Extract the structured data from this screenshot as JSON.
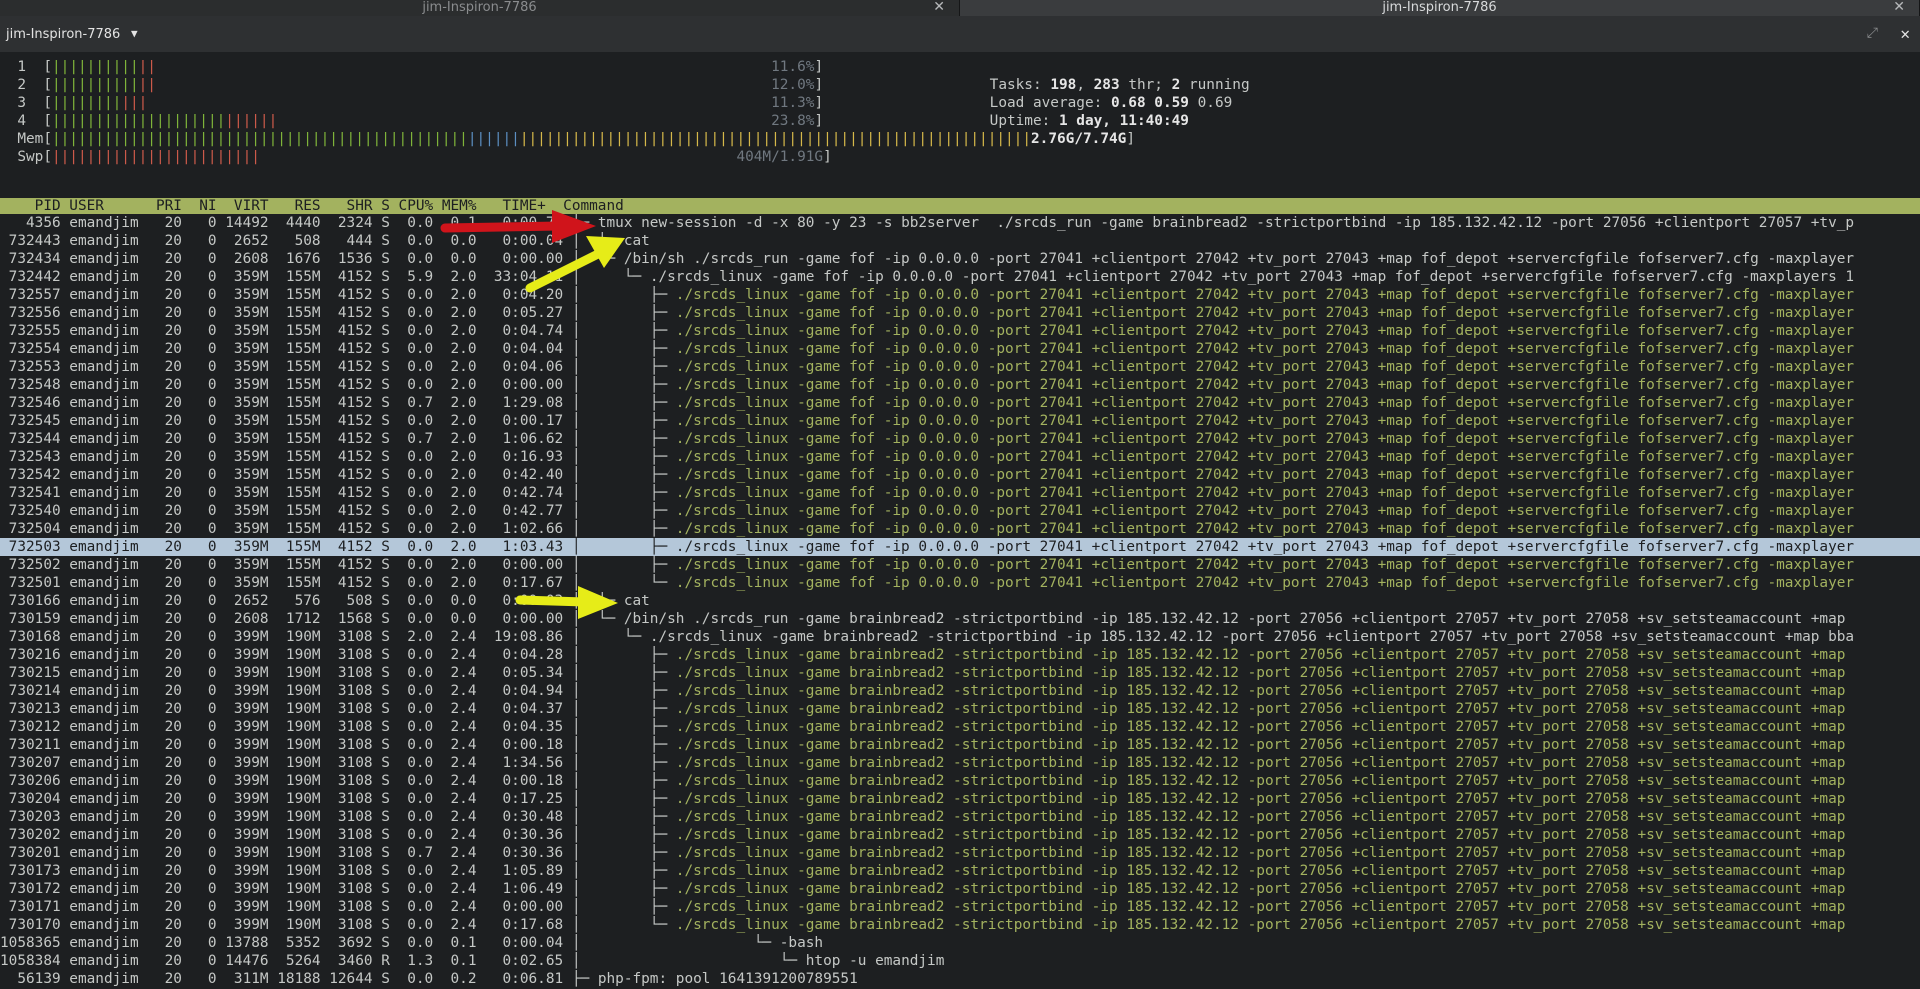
{
  "tabs": [
    {
      "label": "jim-Inspiron-7786",
      "active": false
    },
    {
      "label": "jim-Inspiron-7786",
      "active": true
    }
  ],
  "window": {
    "title": "jim-Inspiron-7786"
  },
  "meters": {
    "cpus": [
      {
        "id": "1",
        "g": "||||||||||",
        "r": "||",
        "value": "11.6%"
      },
      {
        "id": "2",
        "g": "||||||||||",
        "r": "||",
        "value": "12.0%"
      },
      {
        "id": "3",
        "g": "||||||||",
        "r": "|||",
        "value": "11.3%"
      },
      {
        "id": "4",
        "g": "||||||||||||||||||||",
        "r": "||||||",
        "value": "23.8%"
      }
    ],
    "mem": {
      "label": "Mem",
      "g": "||||||||||||||||||||||||||||||||||||||||||||||||",
      "b": "||||||",
      "y": "|||||||||||||||||||||||||||||||||||||||||||||||||||||||||||",
      "value": "2.76G/7.74G"
    },
    "swp": {
      "label": "Swp",
      "r": "||||||||||||||||||||||||",
      "value": "404M/1.91G"
    }
  },
  "summary": {
    "tasks_label": "Tasks:",
    "tasks": "198",
    "thr": "283",
    "thr_label": "thr;",
    "running": "2",
    "running_label": "running",
    "load_label": "Load average:",
    "load1": "0.68",
    "load5": "0.59",
    "load15": "0.69",
    "uptime_label": "Uptime:",
    "uptime": "1 day, 11:40:49"
  },
  "header": "    PID USER      PRI  NI  VIRT   RES   SHR S CPU% MEM%   TIME+  Command",
  "processes": [
    {
      "pid": "4356",
      "user": "emandjim",
      "pri": "20",
      "ni": "0",
      "virt": "14492",
      "res": "4440",
      "shr": "2324",
      "s": "S",
      "cpu": "0.0",
      "mem": "0.1",
      "time": "0:00.72",
      "tree": "├─ ",
      "cmd": "tmux new-session -d -x 80 -y 23 -s bb2server  ./srcds_run -game brainbread2 -strictportbind -ip 185.132.42.12 -port 27056 +clientport 27057 +tv_p",
      "g": false
    },
    {
      "pid": "732443",
      "user": "emandjim",
      "pri": "20",
      "ni": "0",
      "virt": "2652",
      "res": "508",
      "shr": "444",
      "s": "S",
      "cpu": "0.0",
      "mem": "0.0",
      "time": "0:00.04",
      "tree": "│  ├─ ",
      "cmd": "cat",
      "g": false
    },
    {
      "pid": "732434",
      "user": "emandjim",
      "pri": "20",
      "ni": "0",
      "virt": "2608",
      "res": "1676",
      "shr": "1536",
      "s": "S",
      "cpu": "0.0",
      "mem": "0.0",
      "time": "0:00.00",
      "tree": "│  └─ ",
      "cmd": "/bin/sh ./srcds_run -game fof -ip 0.0.0.0 -port 27041 +clientport 27042 +tv_port 27043 +map fof_depot +servercfgfile fofserver7.cfg -maxplayer",
      "g": false
    },
    {
      "pid": "732442",
      "user": "emandjim",
      "pri": "20",
      "ni": "0",
      "virt": "359M",
      "res": "155M",
      "shr": "4152",
      "s": "S",
      "cpu": "5.9",
      "mem": "2.0",
      "time": "33:04.11",
      "tree": "│     └─ ",
      "cmd": "./srcds_linux -game fof -ip 0.0.0.0 -port 27041 +clientport 27042 +tv_port 27043 +map fof_depot +servercfgfile fofserver7.cfg -maxplayers 1",
      "g": false
    },
    {
      "pid": "732557",
      "user": "emandjim",
      "pri": "20",
      "ni": "0",
      "virt": "359M",
      "res": "155M",
      "shr": "4152",
      "s": "S",
      "cpu": "0.0",
      "mem": "2.0",
      "time": "0:04.20",
      "tree": "│        ├─ ",
      "cmd": "./srcds_linux -game fof -ip 0.0.0.0 -port 27041 +clientport 27042 +tv_port 27043 +map fof_depot +servercfgfile fofserver7.cfg -maxplayer",
      "g": true
    },
    {
      "pid": "732556",
      "user": "emandjim",
      "pri": "20",
      "ni": "0",
      "virt": "359M",
      "res": "155M",
      "shr": "4152",
      "s": "S",
      "cpu": "0.0",
      "mem": "2.0",
      "time": "0:05.27",
      "tree": "│        ├─ ",
      "cmd": "./srcds_linux -game fof -ip 0.0.0.0 -port 27041 +clientport 27042 +tv_port 27043 +map fof_depot +servercfgfile fofserver7.cfg -maxplayer",
      "g": true
    },
    {
      "pid": "732555",
      "user": "emandjim",
      "pri": "20",
      "ni": "0",
      "virt": "359M",
      "res": "155M",
      "shr": "4152",
      "s": "S",
      "cpu": "0.0",
      "mem": "2.0",
      "time": "0:04.74",
      "tree": "│        ├─ ",
      "cmd": "./srcds_linux -game fof -ip 0.0.0.0 -port 27041 +clientport 27042 +tv_port 27043 +map fof_depot +servercfgfile fofserver7.cfg -maxplayer",
      "g": true
    },
    {
      "pid": "732554",
      "user": "emandjim",
      "pri": "20",
      "ni": "0",
      "virt": "359M",
      "res": "155M",
      "shr": "4152",
      "s": "S",
      "cpu": "0.0",
      "mem": "2.0",
      "time": "0:04.04",
      "tree": "│        ├─ ",
      "cmd": "./srcds_linux -game fof -ip 0.0.0.0 -port 27041 +clientport 27042 +tv_port 27043 +map fof_depot +servercfgfile fofserver7.cfg -maxplayer",
      "g": true
    },
    {
      "pid": "732553",
      "user": "emandjim",
      "pri": "20",
      "ni": "0",
      "virt": "359M",
      "res": "155M",
      "shr": "4152",
      "s": "S",
      "cpu": "0.0",
      "mem": "2.0",
      "time": "0:04.06",
      "tree": "│        ├─ ",
      "cmd": "./srcds_linux -game fof -ip 0.0.0.0 -port 27041 +clientport 27042 +tv_port 27043 +map fof_depot +servercfgfile fofserver7.cfg -maxplayer",
      "g": true
    },
    {
      "pid": "732548",
      "user": "emandjim",
      "pri": "20",
      "ni": "0",
      "virt": "359M",
      "res": "155M",
      "shr": "4152",
      "s": "S",
      "cpu": "0.0",
      "mem": "2.0",
      "time": "0:00.00",
      "tree": "│        ├─ ",
      "cmd": "./srcds_linux -game fof -ip 0.0.0.0 -port 27041 +clientport 27042 +tv_port 27043 +map fof_depot +servercfgfile fofserver7.cfg -maxplayer",
      "g": true
    },
    {
      "pid": "732546",
      "user": "emandjim",
      "pri": "20",
      "ni": "0",
      "virt": "359M",
      "res": "155M",
      "shr": "4152",
      "s": "S",
      "cpu": "0.7",
      "mem": "2.0",
      "time": "1:29.08",
      "tree": "│        ├─ ",
      "cmd": "./srcds_linux -game fof -ip 0.0.0.0 -port 27041 +clientport 27042 +tv_port 27043 +map fof_depot +servercfgfile fofserver7.cfg -maxplayer",
      "g": true
    },
    {
      "pid": "732545",
      "user": "emandjim",
      "pri": "20",
      "ni": "0",
      "virt": "359M",
      "res": "155M",
      "shr": "4152",
      "s": "S",
      "cpu": "0.0",
      "mem": "2.0",
      "time": "0:00.17",
      "tree": "│        ├─ ",
      "cmd": "./srcds_linux -game fof -ip 0.0.0.0 -port 27041 +clientport 27042 +tv_port 27043 +map fof_depot +servercfgfile fofserver7.cfg -maxplayer",
      "g": true
    },
    {
      "pid": "732544",
      "user": "emandjim",
      "pri": "20",
      "ni": "0",
      "virt": "359M",
      "res": "155M",
      "shr": "4152",
      "s": "S",
      "cpu": "0.7",
      "mem": "2.0",
      "time": "1:06.62",
      "tree": "│        ├─ ",
      "cmd": "./srcds_linux -game fof -ip 0.0.0.0 -port 27041 +clientport 27042 +tv_port 27043 +map fof_depot +servercfgfile fofserver7.cfg -maxplayer",
      "g": true
    },
    {
      "pid": "732543",
      "user": "emandjim",
      "pri": "20",
      "ni": "0",
      "virt": "359M",
      "res": "155M",
      "shr": "4152",
      "s": "S",
      "cpu": "0.0",
      "mem": "2.0",
      "time": "0:16.93",
      "tree": "│        ├─ ",
      "cmd": "./srcds_linux -game fof -ip 0.0.0.0 -port 27041 +clientport 27042 +tv_port 27043 +map fof_depot +servercfgfile fofserver7.cfg -maxplayer",
      "g": true
    },
    {
      "pid": "732542",
      "user": "emandjim",
      "pri": "20",
      "ni": "0",
      "virt": "359M",
      "res": "155M",
      "shr": "4152",
      "s": "S",
      "cpu": "0.0",
      "mem": "2.0",
      "time": "0:42.40",
      "tree": "│        ├─ ",
      "cmd": "./srcds_linux -game fof -ip 0.0.0.0 -port 27041 +clientport 27042 +tv_port 27043 +map fof_depot +servercfgfile fofserver7.cfg -maxplayer",
      "g": true
    },
    {
      "pid": "732541",
      "user": "emandjim",
      "pri": "20",
      "ni": "0",
      "virt": "359M",
      "res": "155M",
      "shr": "4152",
      "s": "S",
      "cpu": "0.0",
      "mem": "2.0",
      "time": "0:42.74",
      "tree": "│        ├─ ",
      "cmd": "./srcds_linux -game fof -ip 0.0.0.0 -port 27041 +clientport 27042 +tv_port 27043 +map fof_depot +servercfgfile fofserver7.cfg -maxplayer",
      "g": true
    },
    {
      "pid": "732540",
      "user": "emandjim",
      "pri": "20",
      "ni": "0",
      "virt": "359M",
      "res": "155M",
      "shr": "4152",
      "s": "S",
      "cpu": "0.0",
      "mem": "2.0",
      "time": "0:42.77",
      "tree": "│        ├─ ",
      "cmd": "./srcds_linux -game fof -ip 0.0.0.0 -port 27041 +clientport 27042 +tv_port 27043 +map fof_depot +servercfgfile fofserver7.cfg -maxplayer",
      "g": true
    },
    {
      "pid": "732504",
      "user": "emandjim",
      "pri": "20",
      "ni": "0",
      "virt": "359M",
      "res": "155M",
      "shr": "4152",
      "s": "S",
      "cpu": "0.0",
      "mem": "2.0",
      "time": "1:02.66",
      "tree": "│        ├─ ",
      "cmd": "./srcds_linux -game fof -ip 0.0.0.0 -port 27041 +clientport 27042 +tv_port 27043 +map fof_depot +servercfgfile fofserver7.cfg -maxplayer",
      "g": true
    },
    {
      "pid": "732503",
      "user": "emandjim",
      "pri": "20",
      "ni": "0",
      "virt": "359M",
      "res": "155M",
      "shr": "4152",
      "s": "S",
      "cpu": "0.0",
      "mem": "2.0",
      "time": "1:03.43",
      "tree": "│        ├─ ",
      "cmd": "./srcds_linux -game fof -ip 0.0.0.0 -port 27041 +clientport 27042 +tv_port 27043 +map fof_depot +servercfgfile fofserver7.cfg -maxplayer",
      "g": true,
      "sel": true
    },
    {
      "pid": "732502",
      "user": "emandjim",
      "pri": "20",
      "ni": "0",
      "virt": "359M",
      "res": "155M",
      "shr": "4152",
      "s": "S",
      "cpu": "0.0",
      "mem": "2.0",
      "time": "0:00.00",
      "tree": "│        ├─ ",
      "cmd": "./srcds_linux -game fof -ip 0.0.0.0 -port 27041 +clientport 27042 +tv_port 27043 +map fof_depot +servercfgfile fofserver7.cfg -maxplayer",
      "g": true
    },
    {
      "pid": "732501",
      "user": "emandjim",
      "pri": "20",
      "ni": "0",
      "virt": "359M",
      "res": "155M",
      "shr": "4152",
      "s": "S",
      "cpu": "0.0",
      "mem": "2.0",
      "time": "0:17.67",
      "tree": "│        └─ ",
      "cmd": "./srcds_linux -game fof -ip 0.0.0.0 -port 27041 +clientport 27042 +tv_port 27043 +map fof_depot +servercfgfile fofserver7.cfg -maxplayer",
      "g": true
    },
    {
      "pid": "730166",
      "user": "emandjim",
      "pri": "20",
      "ni": "0",
      "virt": "2652",
      "res": "576",
      "shr": "508",
      "s": "S",
      "cpu": "0.0",
      "mem": "0.0",
      "time": "0:00.03",
      "tree": "│  ├─ ",
      "cmd": "cat",
      "g": false
    },
    {
      "pid": "730159",
      "user": "emandjim",
      "pri": "20",
      "ni": "0",
      "virt": "2608",
      "res": "1712",
      "shr": "1568",
      "s": "S",
      "cpu": "0.0",
      "mem": "0.0",
      "time": "0:00.00",
      "tree": "│  └─ ",
      "cmd": "/bin/sh ./srcds_run -game brainbread2 -strictportbind -ip 185.132.42.12 -port 27056 +clientport 27057 +tv_port 27058 +sv_setsteamaccount +map",
      "g": false
    },
    {
      "pid": "730168",
      "user": "emandjim",
      "pri": "20",
      "ni": "0",
      "virt": "399M",
      "res": "190M",
      "shr": "3108",
      "s": "S",
      "cpu": "2.0",
      "mem": "2.4",
      "time": "19:08.86",
      "tree": "│     └─ ",
      "cmd": "./srcds_linux -game brainbread2 -strictportbind -ip 185.132.42.12 -port 27056 +clientport 27057 +tv_port 27058 +sv_setsteamaccount +map bba",
      "g": false
    },
    {
      "pid": "730216",
      "user": "emandjim",
      "pri": "20",
      "ni": "0",
      "virt": "399M",
      "res": "190M",
      "shr": "3108",
      "s": "S",
      "cpu": "0.0",
      "mem": "2.4",
      "time": "0:04.28",
      "tree": "│        ├─ ",
      "cmd": "./srcds_linux -game brainbread2 -strictportbind -ip 185.132.42.12 -port 27056 +clientport 27057 +tv_port 27058 +sv_setsteamaccount +map",
      "g": true
    },
    {
      "pid": "730215",
      "user": "emandjim",
      "pri": "20",
      "ni": "0",
      "virt": "399M",
      "res": "190M",
      "shr": "3108",
      "s": "S",
      "cpu": "0.0",
      "mem": "2.4",
      "time": "0:05.34",
      "tree": "│        ├─ ",
      "cmd": "./srcds_linux -game brainbread2 -strictportbind -ip 185.132.42.12 -port 27056 +clientport 27057 +tv_port 27058 +sv_setsteamaccount +map",
      "g": true
    },
    {
      "pid": "730214",
      "user": "emandjim",
      "pri": "20",
      "ni": "0",
      "virt": "399M",
      "res": "190M",
      "shr": "3108",
      "s": "S",
      "cpu": "0.0",
      "mem": "2.4",
      "time": "0:04.94",
      "tree": "│        ├─ ",
      "cmd": "./srcds_linux -game brainbread2 -strictportbind -ip 185.132.42.12 -port 27056 +clientport 27057 +tv_port 27058 +sv_setsteamaccount +map",
      "g": true
    },
    {
      "pid": "730213",
      "user": "emandjim",
      "pri": "20",
      "ni": "0",
      "virt": "399M",
      "res": "190M",
      "shr": "3108",
      "s": "S",
      "cpu": "0.0",
      "mem": "2.4",
      "time": "0:04.37",
      "tree": "│        ├─ ",
      "cmd": "./srcds_linux -game brainbread2 -strictportbind -ip 185.132.42.12 -port 27056 +clientport 27057 +tv_port 27058 +sv_setsteamaccount +map",
      "g": true
    },
    {
      "pid": "730212",
      "user": "emandjim",
      "pri": "20",
      "ni": "0",
      "virt": "399M",
      "res": "190M",
      "shr": "3108",
      "s": "S",
      "cpu": "0.0",
      "mem": "2.4",
      "time": "0:04.35",
      "tree": "│        ├─ ",
      "cmd": "./srcds_linux -game brainbread2 -strictportbind -ip 185.132.42.12 -port 27056 +clientport 27057 +tv_port 27058 +sv_setsteamaccount +map",
      "g": true
    },
    {
      "pid": "730211",
      "user": "emandjim",
      "pri": "20",
      "ni": "0",
      "virt": "399M",
      "res": "190M",
      "shr": "3108",
      "s": "S",
      "cpu": "0.0",
      "mem": "2.4",
      "time": "0:00.18",
      "tree": "│        ├─ ",
      "cmd": "./srcds_linux -game brainbread2 -strictportbind -ip 185.132.42.12 -port 27056 +clientport 27057 +tv_port 27058 +sv_setsteamaccount +map",
      "g": true
    },
    {
      "pid": "730207",
      "user": "emandjim",
      "pri": "20",
      "ni": "0",
      "virt": "399M",
      "res": "190M",
      "shr": "3108",
      "s": "S",
      "cpu": "0.0",
      "mem": "2.4",
      "time": "1:34.56",
      "tree": "│        ├─ ",
      "cmd": "./srcds_linux -game brainbread2 -strictportbind -ip 185.132.42.12 -port 27056 +clientport 27057 +tv_port 27058 +sv_setsteamaccount +map",
      "g": true
    },
    {
      "pid": "730206",
      "user": "emandjim",
      "pri": "20",
      "ni": "0",
      "virt": "399M",
      "res": "190M",
      "shr": "3108",
      "s": "S",
      "cpu": "0.0",
      "mem": "2.4",
      "time": "0:00.18",
      "tree": "│        ├─ ",
      "cmd": "./srcds_linux -game brainbread2 -strictportbind -ip 185.132.42.12 -port 27056 +clientport 27057 +tv_port 27058 +sv_setsteamaccount +map",
      "g": true
    },
    {
      "pid": "730204",
      "user": "emandjim",
      "pri": "20",
      "ni": "0",
      "virt": "399M",
      "res": "190M",
      "shr": "3108",
      "s": "S",
      "cpu": "0.0",
      "mem": "2.4",
      "time": "0:17.25",
      "tree": "│        ├─ ",
      "cmd": "./srcds_linux -game brainbread2 -strictportbind -ip 185.132.42.12 -port 27056 +clientport 27057 +tv_port 27058 +sv_setsteamaccount +map",
      "g": true
    },
    {
      "pid": "730203",
      "user": "emandjim",
      "pri": "20",
      "ni": "0",
      "virt": "399M",
      "res": "190M",
      "shr": "3108",
      "s": "S",
      "cpu": "0.0",
      "mem": "2.4",
      "time": "0:30.48",
      "tree": "│        ├─ ",
      "cmd": "./srcds_linux -game brainbread2 -strictportbind -ip 185.132.42.12 -port 27056 +clientport 27057 +tv_port 27058 +sv_setsteamaccount +map",
      "g": true
    },
    {
      "pid": "730202",
      "user": "emandjim",
      "pri": "20",
      "ni": "0",
      "virt": "399M",
      "res": "190M",
      "shr": "3108",
      "s": "S",
      "cpu": "0.0",
      "mem": "2.4",
      "time": "0:30.36",
      "tree": "│        ├─ ",
      "cmd": "./srcds_linux -game brainbread2 -strictportbind -ip 185.132.42.12 -port 27056 +clientport 27057 +tv_port 27058 +sv_setsteamaccount +map",
      "g": true
    },
    {
      "pid": "730201",
      "user": "emandjim",
      "pri": "20",
      "ni": "0",
      "virt": "399M",
      "res": "190M",
      "shr": "3108",
      "s": "S",
      "cpu": "0.7",
      "mem": "2.4",
      "time": "0:30.36",
      "tree": "│        ├─ ",
      "cmd": "./srcds_linux -game brainbread2 -strictportbind -ip 185.132.42.12 -port 27056 +clientport 27057 +tv_port 27058 +sv_setsteamaccount +map",
      "g": true
    },
    {
      "pid": "730173",
      "user": "emandjim",
      "pri": "20",
      "ni": "0",
      "virt": "399M",
      "res": "190M",
      "shr": "3108",
      "s": "S",
      "cpu": "0.0",
      "mem": "2.4",
      "time": "1:05.89",
      "tree": "│        ├─ ",
      "cmd": "./srcds_linux -game brainbread2 -strictportbind -ip 185.132.42.12 -port 27056 +clientport 27057 +tv_port 27058 +sv_setsteamaccount +map",
      "g": true
    },
    {
      "pid": "730172",
      "user": "emandjim",
      "pri": "20",
      "ni": "0",
      "virt": "399M",
      "res": "190M",
      "shr": "3108",
      "s": "S",
      "cpu": "0.0",
      "mem": "2.4",
      "time": "1:06.49",
      "tree": "│        ├─ ",
      "cmd": "./srcds_linux -game brainbread2 -strictportbind -ip 185.132.42.12 -port 27056 +clientport 27057 +tv_port 27058 +sv_setsteamaccount +map",
      "g": true
    },
    {
      "pid": "730171",
      "user": "emandjim",
      "pri": "20",
      "ni": "0",
      "virt": "399M",
      "res": "190M",
      "shr": "3108",
      "s": "S",
      "cpu": "0.0",
      "mem": "2.4",
      "time": "0:00.00",
      "tree": "│        ├─ ",
      "cmd": "./srcds_linux -game brainbread2 -strictportbind -ip 185.132.42.12 -port 27056 +clientport 27057 +tv_port 27058 +sv_setsteamaccount +map",
      "g": true
    },
    {
      "pid": "730170",
      "user": "emandjim",
      "pri": "20",
      "ni": "0",
      "virt": "399M",
      "res": "190M",
      "shr": "3108",
      "s": "S",
      "cpu": "0.0",
      "mem": "2.4",
      "time": "0:17.68",
      "tree": "│        └─ ",
      "cmd": "./srcds_linux -game brainbread2 -strictportbind -ip 185.132.42.12 -port 27056 +clientport 27057 +tv_port 27058 +sv_setsteamaccount +map",
      "g": true
    },
    {
      "pid": "1058365",
      "user": "emandjim",
      "pri": "20",
      "ni": "0",
      "virt": "13788",
      "res": "5352",
      "shr": "3692",
      "s": "S",
      "cpu": "0.0",
      "mem": "0.1",
      "time": "0:00.04",
      "tree": "│                    └─ ",
      "cmd": "-bash",
      "g": false
    },
    {
      "pid": "1058384",
      "user": "emandjim",
      "pri": "20",
      "ni": "0",
      "virt": "14476",
      "res": "5264",
      "shr": "3460",
      "s": "R",
      "cpu": "1.3",
      "mem": "0.1",
      "time": "0:02.65",
      "tree": "│                       └─ ",
      "cmd": "htop -u emandjim",
      "g": false
    },
    {
      "pid": "56139",
      "user": "emandjim",
      "pri": "20",
      "ni": "0",
      "virt": "311M",
      "res": "18188",
      "shr": "12644",
      "s": "S",
      "cpu": "0.0",
      "mem": "0.2",
      "time": "0:06.81",
      "tree": "├─ ",
      "cmd": "php-fpm: pool 1641391200789551",
      "g": false
    }
  ],
  "annotation_colors": {
    "red": "#d0141b",
    "yellow": "#e6ec18"
  }
}
